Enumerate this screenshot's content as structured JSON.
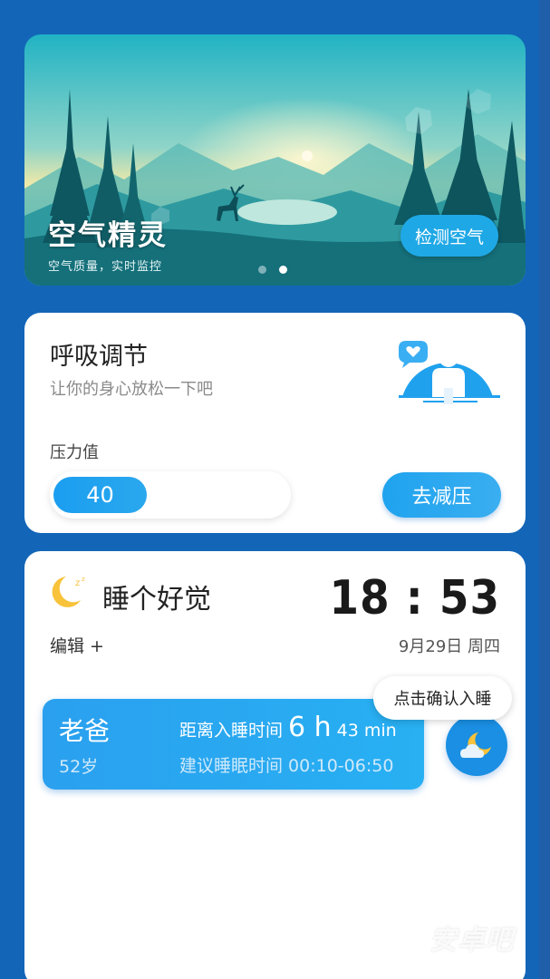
{
  "banner": {
    "title": "空气精灵",
    "subtitle": "空气质量，实时监控",
    "button_label": "检测空气",
    "page_count": 2,
    "active_page": 2
  },
  "breathing": {
    "title": "呼吸调节",
    "subtitle": "让你的身心放松一下吧",
    "pressure_label": "压力值",
    "pressure_value": "40",
    "pressure_level": 0.4,
    "button_label": "去减压",
    "illustration_icon": "person-heart-icon"
  },
  "sleep": {
    "title": "睡个好觉",
    "edit_label": "编辑 +",
    "time": "18 : 53",
    "date": "9月29日 周四",
    "confirm_tip": "点击确认入睡",
    "member": {
      "name": "老爸",
      "age": "52岁",
      "distance_label": "距离入睡时间",
      "distance_hours": "6 h",
      "distance_minutes": "43 min",
      "suggest": "建议睡眠时间 00:10-06:50"
    }
  },
  "watermark": {
    "text": "安卓吧",
    "url": "www.anzhuo8.com"
  },
  "colors": {
    "background": "#1366b7",
    "accent": "#1fa3ef",
    "card": "#ffffff"
  }
}
